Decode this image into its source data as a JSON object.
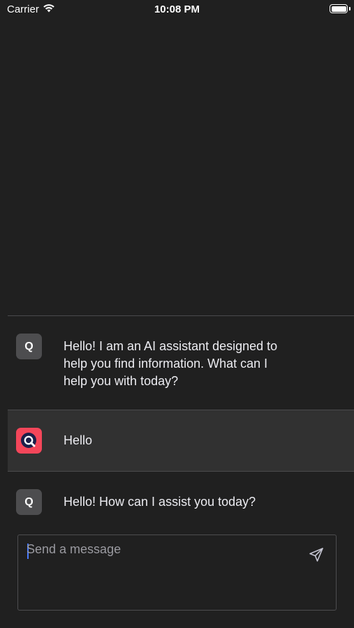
{
  "status_bar": {
    "carrier": "Carrier",
    "time": "10:08 PM",
    "icons": [
      "wifi-icon",
      "battery-icon"
    ]
  },
  "chat": {
    "messages": [
      {
        "role": "assistant",
        "avatar_letter": "Q",
        "text": "Hello! I am an AI assistant designed to help you find information. What can I help you with today?"
      },
      {
        "role": "user",
        "avatar_icon": "app-logo-icon",
        "text": "Hello"
      },
      {
        "role": "assistant",
        "avatar_letter": "Q",
        "text": "Hello! How can I assist you today?"
      }
    ]
  },
  "composer": {
    "placeholder": "Send a message",
    "value": "",
    "send_icon": "send-icon"
  },
  "colors": {
    "background": "#202020",
    "user_row": "#313131",
    "bot_avatar": "#4d4d4f",
    "user_avatar": "#f4465a",
    "text": "#ececf1",
    "caret": "#4a7cff"
  }
}
